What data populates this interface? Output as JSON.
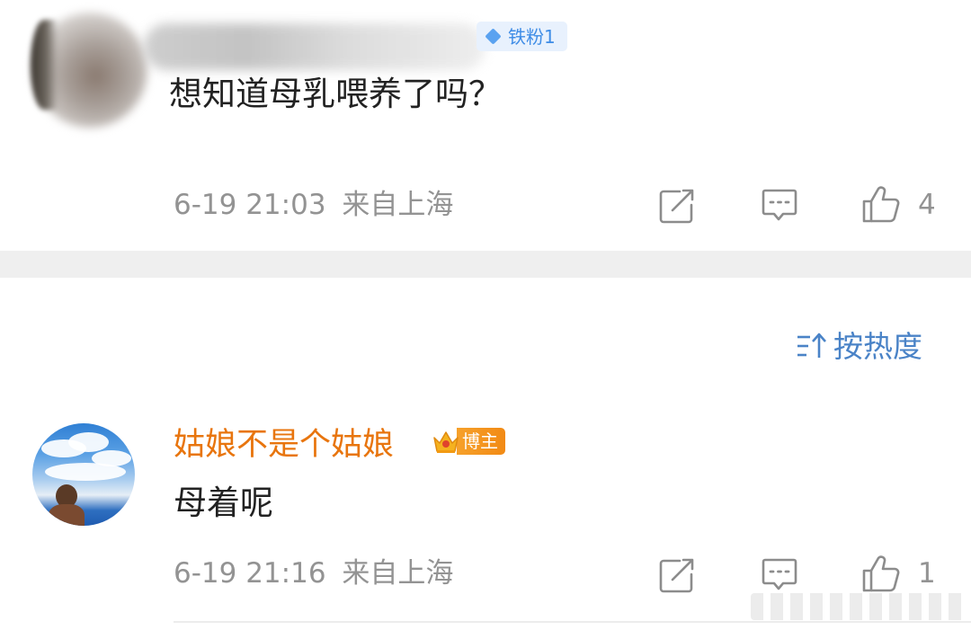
{
  "post": {
    "fan_badge": "铁粉1",
    "text": "想知道母乳喂养了吗？",
    "time": "6-19 21:03",
    "location": "来自上海",
    "like_count": "4"
  },
  "sort": {
    "label": "按热度"
  },
  "reply": {
    "username": "姑娘不是个姑娘",
    "badge": "博主",
    "text": "母着呢",
    "time": "6-19 21:16",
    "location": "来自上海",
    "like_count": "1"
  },
  "colors": {
    "accent_blue": "#4a83c7",
    "username_orange": "#e8750e",
    "meta_gray": "#939393"
  }
}
